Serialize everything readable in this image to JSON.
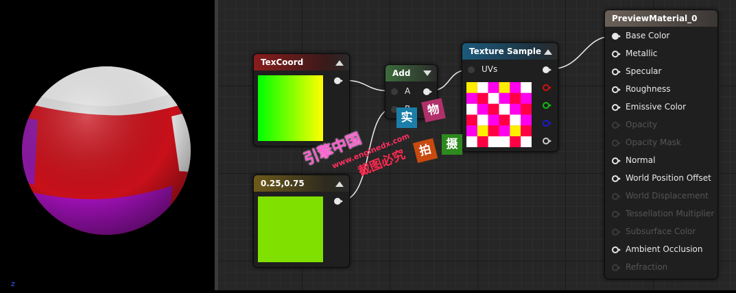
{
  "preview": {
    "corner_glyph": "z"
  },
  "nodes": {
    "texcoord": {
      "title": "TexCoord",
      "header_color": "#8a1c1c"
    },
    "constant": {
      "title": "0.25,0.75",
      "header_color": "#6e5a1a",
      "swatch_color": "#80e000"
    },
    "add": {
      "title": "Add",
      "header_color": "#3d6b3d",
      "input_a": "A",
      "input_b": "B"
    },
    "texture": {
      "title": "Texture Sample",
      "header_color": "#1c5a7c",
      "input_uvs": "UVs"
    },
    "material": {
      "title": "PreviewMaterial_0",
      "header_color": "#6b6058",
      "inputs": [
        {
          "label": "Base Color",
          "enabled": true
        },
        {
          "label": "Metallic",
          "enabled": true
        },
        {
          "label": "Specular",
          "enabled": true
        },
        {
          "label": "Roughness",
          "enabled": true
        },
        {
          "label": "Emissive Color",
          "enabled": true
        },
        {
          "label": "Opacity",
          "enabled": false
        },
        {
          "label": "Opacity Mask",
          "enabled": false
        },
        {
          "label": "Normal",
          "enabled": true
        },
        {
          "label": "World Position Offset",
          "enabled": true
        },
        {
          "label": "World Displacement",
          "enabled": false
        },
        {
          "label": "Tessellation Multiplier",
          "enabled": false
        },
        {
          "label": "Subsurface Color",
          "enabled": false
        },
        {
          "label": "Ambient Occlusion",
          "enabled": true
        },
        {
          "label": "Refraction",
          "enabled": false
        }
      ]
    }
  },
  "pin_colors": {
    "red": "#d01010",
    "green": "#10c010",
    "blue": "#1010c0",
    "alpha": "#cfcfcf"
  },
  "watermark": {
    "line1": "引擎中国",
    "url": "www.enginedx.com",
    "line2": "截图必究",
    "stamps": [
      "实",
      "物",
      "拍",
      "摄"
    ]
  }
}
